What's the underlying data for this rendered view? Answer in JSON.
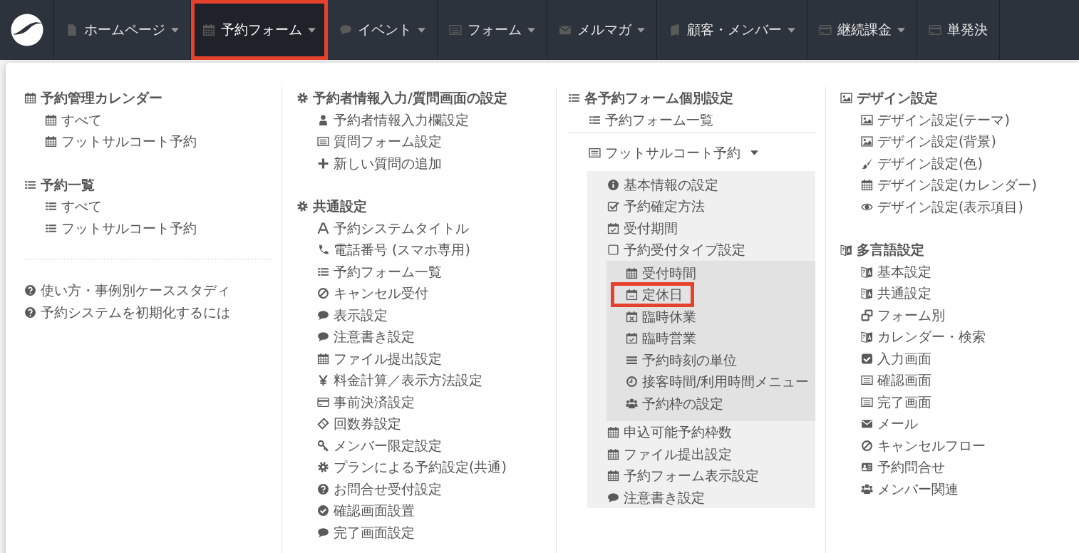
{
  "nav": [
    {
      "label": "ホームページ",
      "kind": "file",
      "selected": false,
      "caret": true
    },
    {
      "label": "予約フォーム",
      "kind": "calendar",
      "selected": true,
      "caret": true
    },
    {
      "label": "イベント",
      "kind": "comment",
      "selected": false,
      "caret": true
    },
    {
      "label": "フォーム",
      "kind": "form",
      "selected": false,
      "caret": true
    },
    {
      "label": "メルマガ",
      "kind": "envelope",
      "selected": false,
      "caret": true
    },
    {
      "label": "顧客・メンバー",
      "kind": "book",
      "selected": false,
      "caret": true
    },
    {
      "label": "継続課金",
      "kind": "card",
      "selected": false,
      "caret": true
    },
    {
      "label": "単発決",
      "kind": "card",
      "selected": false,
      "caret": false
    }
  ],
  "columns": [
    {
      "sections": [
        {
          "title": "予約管理カレンダー",
          "kind": "calendar",
          "items": [
            {
              "label": "すべて",
              "kind": "calendar"
            },
            {
              "label": "フットサルコート予約",
              "kind": "calendar"
            }
          ]
        },
        {
          "title": "予約一覧",
          "kind": "list",
          "items": [
            {
              "label": "すべて",
              "kind": "list"
            },
            {
              "label": "フットサルコート予約",
              "kind": "list"
            }
          ]
        }
      ],
      "links": [
        {
          "label": "使い方・事例別ケーススタディ",
          "kind": "question"
        },
        {
          "label": "予約システムを初期化するには",
          "kind": "question"
        }
      ]
    },
    {
      "sections": [
        {
          "title": "予約者情報入力/質問画面の設定",
          "kind": "gear",
          "items": [
            {
              "label": "予約者情報入力欄設定",
              "kind": "user"
            },
            {
              "label": "質問フォーム設定",
              "kind": "form"
            },
            {
              "label": "新しい質問の追加",
              "kind": "plus"
            }
          ]
        },
        {
          "title": "共通設定",
          "kind": "gear",
          "items": [
            {
              "label": "予約システムタイトル",
              "kind": "font"
            },
            {
              "label": "電話番号 (スマホ専用)",
              "kind": "phone"
            },
            {
              "label": "予約フォーム一覧",
              "kind": "list"
            },
            {
              "label": "キャンセル受付",
              "kind": "ban"
            },
            {
              "label": "表示設定",
              "kind": "comment"
            },
            {
              "label": "注意書き設定",
              "kind": "comment"
            },
            {
              "label": "ファイル提出設定",
              "kind": "calendar"
            },
            {
              "label": "料金計算／表示方法設定",
              "kind": "yen"
            },
            {
              "label": "事前決済設定",
              "kind": "card"
            },
            {
              "label": "回数券設定",
              "kind": "ticket"
            },
            {
              "label": "メンバー限定設定",
              "kind": "key"
            },
            {
              "label": "プランによる予約設定(共通)",
              "kind": "gear"
            },
            {
              "label": "お問合せ受付設定",
              "kind": "question"
            },
            {
              "label": "確認画面設置",
              "kind": "checkcircle"
            },
            {
              "label": "完了画面設定",
              "kind": "comment"
            }
          ]
        }
      ]
    },
    {
      "sections": [
        {
          "title": "各予約フォーム個別設定",
          "kind": "list",
          "items": [
            {
              "label": "予約フォーム一覧",
              "kind": "list"
            }
          ]
        }
      ],
      "form": {
        "label": "フットサルコート予約",
        "kind": "form",
        "expanded": true,
        "items": [
          {
            "label": "基本情報の設定",
            "kind": "info"
          },
          {
            "label": "予約確定方法",
            "kind": "checkbox"
          },
          {
            "label": "受付期間",
            "kind": "calcheck"
          },
          {
            "label": "予約受付タイプ設定",
            "kind": "square",
            "children": [
              {
                "label": "受付時間",
                "kind": "calendar",
                "highlighted": false
              },
              {
                "label": "定休日",
                "kind": "calminus",
                "highlighted": true
              },
              {
                "label": "臨時休業",
                "kind": "calx",
                "highlighted": false
              },
              {
                "label": "臨時営業",
                "kind": "calcheck",
                "highlighted": false
              },
              {
                "label": "予約時刻の単位",
                "kind": "bars",
                "highlighted": false
              },
              {
                "label": "接客時間/利用時間メニュー",
                "kind": "clock",
                "highlighted": false
              },
              {
                "label": "予約枠の設定",
                "kind": "users",
                "highlighted": false
              }
            ]
          },
          {
            "label": "申込可能予約枠数",
            "kind": "calendar"
          },
          {
            "label": "ファイル提出設定",
            "kind": "calendar"
          },
          {
            "label": "予約フォーム表示設定",
            "kind": "calendar"
          },
          {
            "label": "注意書き設定",
            "kind": "comment"
          }
        ]
      }
    },
    {
      "sections": [
        {
          "title": "デザイン設定",
          "kind": "image",
          "items": [
            {
              "label": "デザイン設定(テーマ)",
              "kind": "image"
            },
            {
              "label": "デザイン設定(背景)",
              "kind": "image"
            },
            {
              "label": "デザイン設定(色)",
              "kind": "brush"
            },
            {
              "label": "デザイン設定(カレンダー)",
              "kind": "calendar"
            },
            {
              "label": "デザイン設定(表示項目)",
              "kind": "eye"
            }
          ]
        },
        {
          "title": "多言語設定",
          "kind": "translate",
          "items": [
            {
              "label": "基本設定",
              "kind": "translate"
            },
            {
              "label": "共通設定",
              "kind": "translate"
            },
            {
              "label": "フォーム別",
              "kind": "windows"
            },
            {
              "label": "カレンダー・検索",
              "kind": "translate"
            },
            {
              "label": "入力画面",
              "kind": "checksquare"
            },
            {
              "label": "確認画面",
              "kind": "form"
            },
            {
              "label": "完了画面",
              "kind": "form"
            },
            {
              "label": "メール",
              "kind": "envelope"
            },
            {
              "label": "キャンセルフロー",
              "kind": "ban"
            },
            {
              "label": "予約問合せ",
              "kind": "idcard"
            },
            {
              "label": "メンバー関連",
              "kind": "users"
            }
          ]
        }
      ]
    }
  ]
}
